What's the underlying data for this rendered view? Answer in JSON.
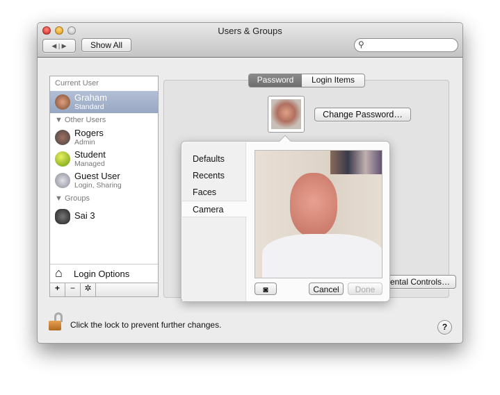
{
  "window": {
    "title": "Users & Groups",
    "show_all": "Show All",
    "search_placeholder": ""
  },
  "sidebar": {
    "current_user_header": "Current User",
    "current_user": {
      "name": "Graham",
      "role": "Standard"
    },
    "other_users_header": "Other Users",
    "other_users": [
      {
        "name": "Rogers",
        "role": "Admin"
      },
      {
        "name": "Student",
        "role": "Managed"
      },
      {
        "name": "Guest User",
        "role": "Login, Sharing"
      }
    ],
    "groups_header": "Groups",
    "groups": [
      {
        "name": "Sai 3"
      }
    ],
    "login_options": "Login Options",
    "add": "+",
    "remove": "−"
  },
  "tabs": [
    {
      "label": "Password",
      "active": true
    },
    {
      "label": "Login Items",
      "active": false
    }
  ],
  "main": {
    "change_password": "Change Password…",
    "parental_controls": "Open Parental Controls…"
  },
  "popover": {
    "menu": [
      "Defaults",
      "Recents",
      "Faces",
      "Camera"
    ],
    "selected": "Camera",
    "cancel": "Cancel",
    "done": "Done"
  },
  "footer": {
    "lock_text": "Click the lock to prevent further changes.",
    "help": "?"
  }
}
